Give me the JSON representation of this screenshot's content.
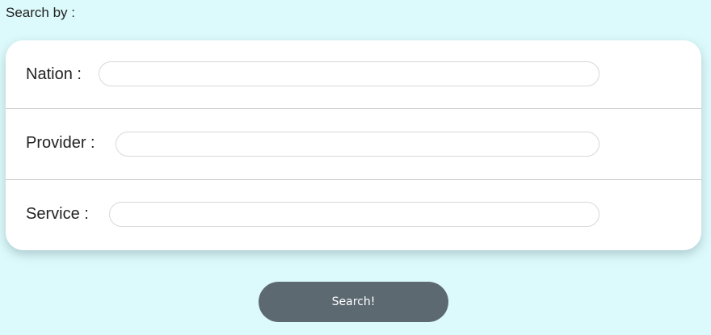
{
  "heading": "Search by :",
  "form": {
    "nation": {
      "label": "Nation :",
      "value": ""
    },
    "provider": {
      "label": "Provider :",
      "value": ""
    },
    "service": {
      "label": "Service :",
      "value": ""
    }
  },
  "search_button_label": "Search!",
  "colors": {
    "background": "#dcf9fb",
    "card": "#ffffff",
    "button": "#5c6971"
  }
}
